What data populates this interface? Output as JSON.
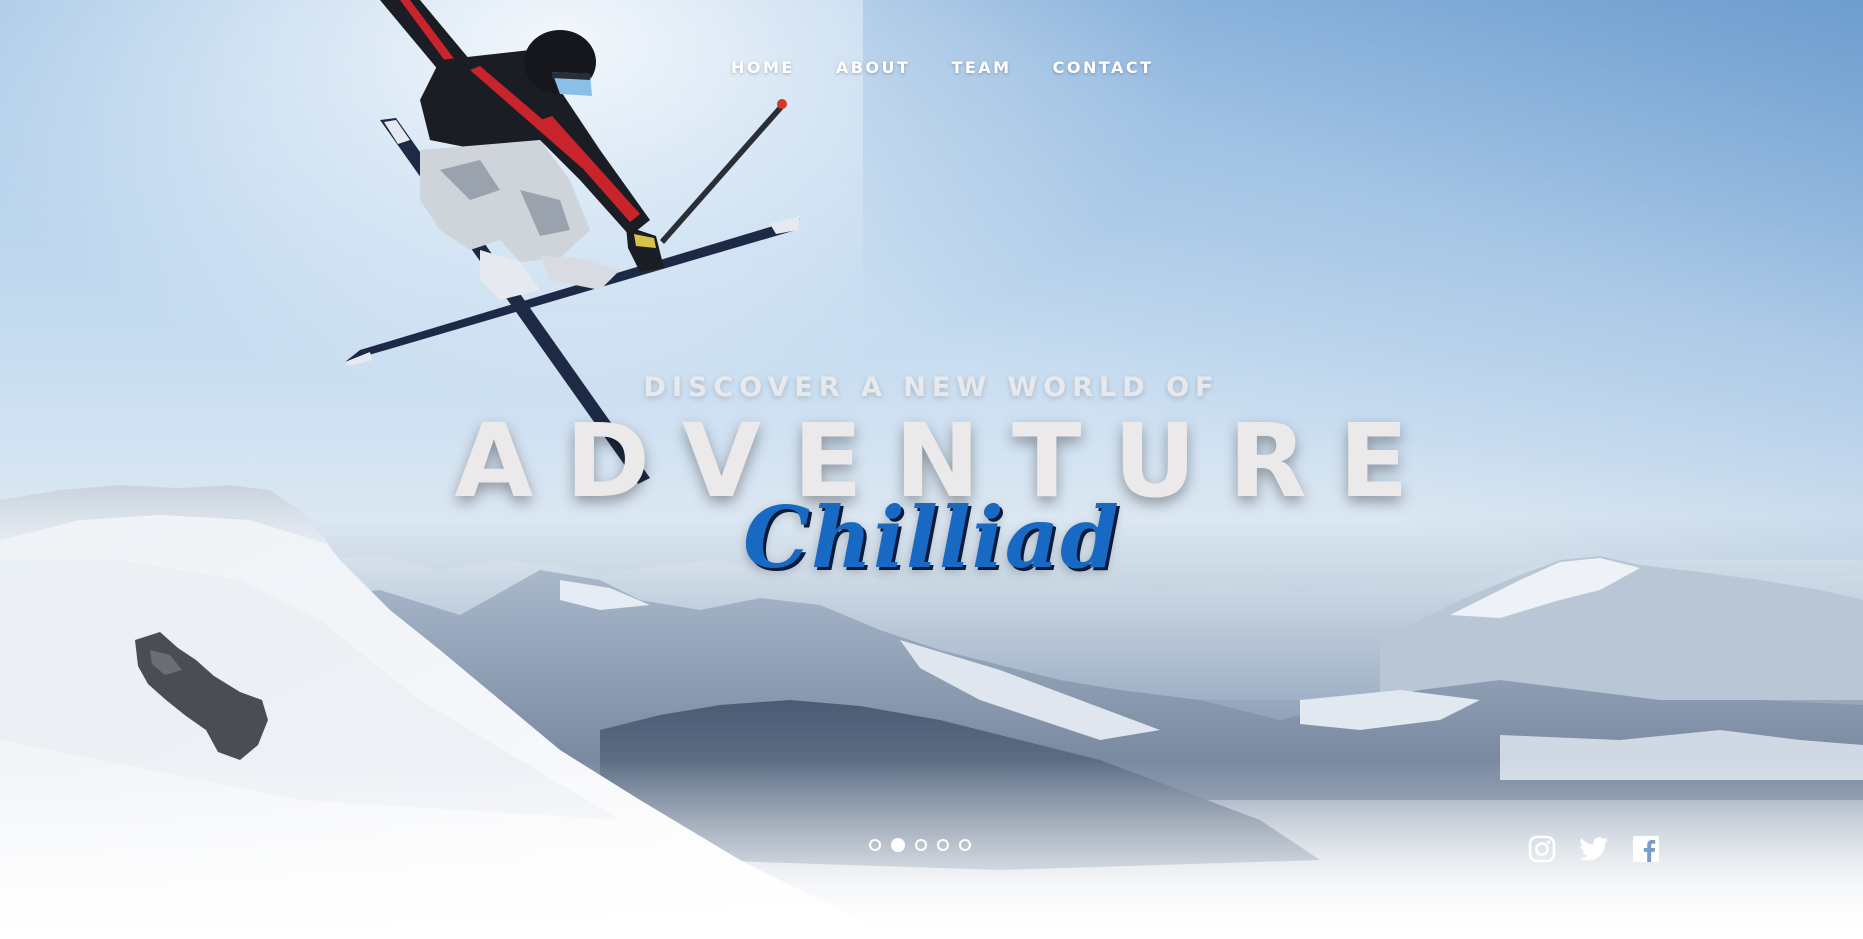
{
  "nav": {
    "items": [
      {
        "label": "HOME"
      },
      {
        "label": "ABOUT"
      },
      {
        "label": "TEAM"
      },
      {
        "label": "CONTACT"
      }
    ]
  },
  "hero": {
    "kicker": "DISCOVER A NEW WORLD OF",
    "headline": "ADVENTURE",
    "brand": "Chilliad"
  },
  "slider": {
    "total_slides": 5,
    "active_slide": 2
  },
  "social": {
    "items": [
      {
        "icon": "instagram-icon"
      },
      {
        "icon": "twitter-icon"
      },
      {
        "icon": "facebook-icon"
      }
    ]
  },
  "colors": {
    "brand_blue": "#1769c4",
    "headline": "#ebe9e9",
    "nav_text": "#ffffff"
  }
}
